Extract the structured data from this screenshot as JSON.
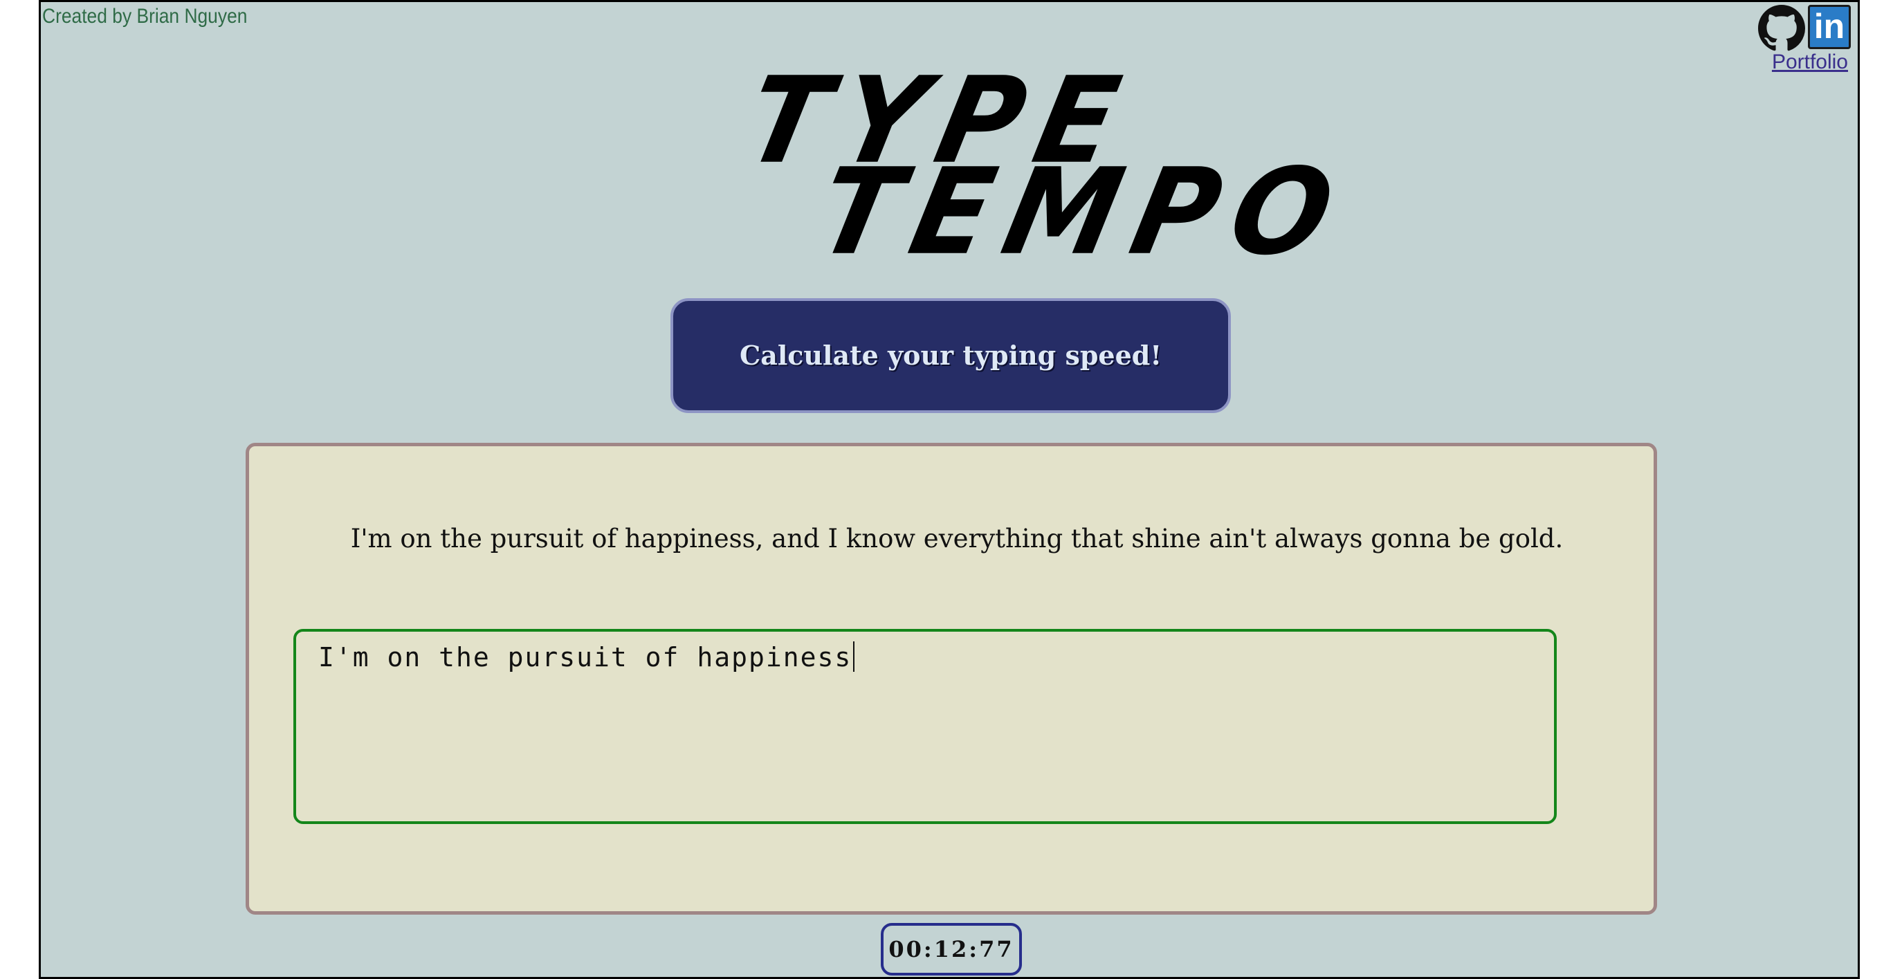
{
  "header": {
    "credit": "Created by Brian Nguyen",
    "social": {
      "github_icon": "github-icon",
      "linkedin_icon": "linkedin-icon",
      "linkedin_text": "in",
      "portfolio_label": "Portfolio"
    }
  },
  "logo": {
    "line1": "TYPE",
    "line2": "TEMPO"
  },
  "cta": {
    "label": "Calculate your typing speed!"
  },
  "test": {
    "prompt": "I'm on the pursuit of happiness, and I know everything that shine ain't always gonna be gold.",
    "typed_value": "I'm on the pursuit of happiness"
  },
  "timer": {
    "value": "00:12:77"
  },
  "colors": {
    "page_background": "#c3d3d3",
    "button": "#262d66",
    "panel": "#e3e2ca",
    "panel_border": "#a08686",
    "input_border": "#14861a",
    "timer_border": "#262d8c",
    "linkedin_blue": "#2a7cc7",
    "credit_text": "#2f6b47"
  }
}
